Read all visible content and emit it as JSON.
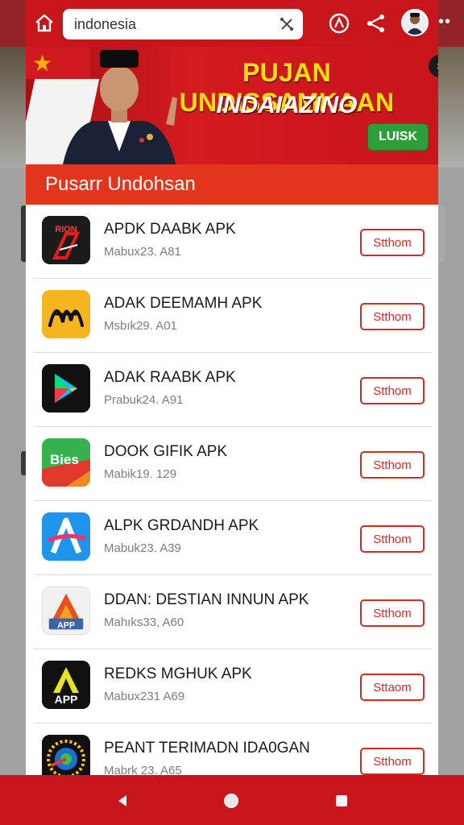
{
  "browser": {
    "url_value": "indonesia",
    "url_placeholder": "",
    "icons": {
      "home": "home-icon",
      "clear": "close-icon",
      "compass": "compass-icon",
      "share": "share-icon",
      "avatar": "avatar",
      "more": "more-icon"
    }
  },
  "banner": {
    "title_line1": "PUJAN UNDISSAMKAAN",
    "title_line2": "INDAIAZINO",
    "button_label": "LUISK",
    "close_label": "×"
  },
  "modal": {
    "title": "Pusarr Undohsan",
    "apps": [
      {
        "name": "APDK DAABK APK",
        "meta": "Mabux23. A81",
        "button": "Stthom",
        "icon": "red-logo-icon"
      },
      {
        "name": "ADAK DEEMAMH APK",
        "meta": "Msbık29. A01",
        "button": "Stthom",
        "icon": "yellow-glyph-icon"
      },
      {
        "name": "ADAK RAABK APK",
        "meta": "Prabuk24. A91",
        "button": "Stthom",
        "icon": "play-store-icon"
      },
      {
        "name": "DOOK GIFIK APK",
        "meta": "Mabik19. 129",
        "button": "Stthom",
        "icon": "bies-icon"
      },
      {
        "name": "ALPK GRDANDH APK",
        "meta": "Mabuk23. A39",
        "button": "Stthom",
        "icon": "letter-a-icon"
      },
      {
        "name": "DDAN: DESTIAN INNUN APK",
        "meta": "Mahıks33, A60",
        "button": "Stthom",
        "icon": "app-triangle-icon"
      },
      {
        "name": "REDKS MGHUK APK",
        "meta": "Mabux231 A69",
        "button": "Sttaom",
        "icon": "app-dark-icon"
      },
      {
        "name": "PEANT TERIMADN IDA0GAN",
        "meta": "Mabrk 23. A65",
        "button": "Stthom",
        "icon": "colorful-ring-icon"
      }
    ]
  },
  "navbar": {
    "icons": [
      "back-icon",
      "home-circle-icon",
      "recents-icon"
    ]
  },
  "colors": {
    "brand_red": "#c8141b",
    "header_orange": "#e3341d",
    "banner_yellow": "#ffe100",
    "banner_green": "#2e9e3a",
    "button_red": "#d32a24"
  }
}
